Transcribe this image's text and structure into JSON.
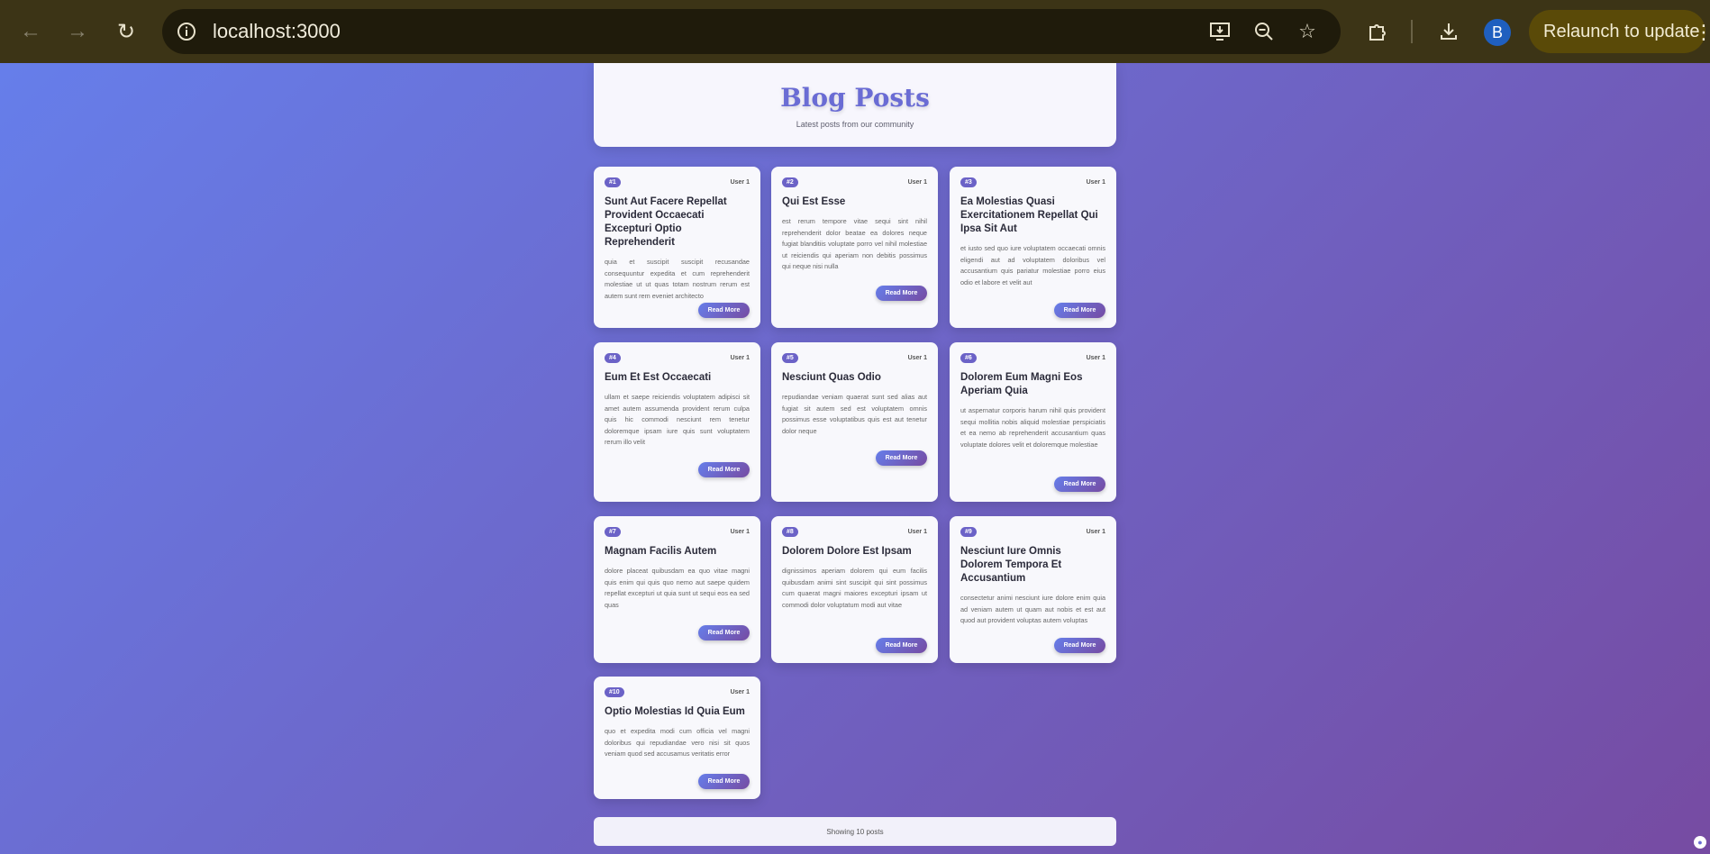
{
  "browser": {
    "url": "localhost:3000",
    "relaunch_label": "Relaunch to update",
    "profile_initial": "B",
    "icons": {
      "back": "arrow-left-icon",
      "forward": "arrow-right-icon",
      "reload": "reload-icon",
      "info": "info-icon",
      "install": "install-app-icon",
      "zoom": "zoom-out-icon",
      "bookmark": "star-icon",
      "extensions": "puzzle-icon",
      "downloads": "download-icon",
      "menu": "kebab-menu-icon"
    }
  },
  "page": {
    "title": "Blog Posts",
    "subtitle": "Latest posts from our community",
    "read_more_label": "Read More",
    "footer": "Showing 10 posts",
    "colors": {
      "gradient_start": "#667eea",
      "gradient_end": "#764ba2",
      "title": "#6a6cd4"
    }
  },
  "posts": [
    {
      "id": "#1",
      "user": "User 1",
      "title": "Sunt Aut Facere Repellat Provident Occaecati Excepturi Optio Reprehenderit",
      "body": "quia et suscipit suscipit recusandae consequuntur expedita et cum reprehenderit molestiae ut ut quas totam nostrum rerum est autem sunt rem eveniet architecto"
    },
    {
      "id": "#2",
      "user": "User 1",
      "title": "Qui Est Esse",
      "body": "est rerum tempore vitae sequi sint nihil reprehenderit dolor beatae ea dolores neque fugiat blanditiis voluptate porro vel nihil molestiae ut reiciendis qui aperiam non debitis possimus qui neque nisi nulla"
    },
    {
      "id": "#3",
      "user": "User 1",
      "title": "Ea Molestias Quasi Exercitationem Repellat Qui Ipsa Sit Aut",
      "body": "et iusto sed quo iure voluptatem occaecati omnis eligendi aut ad voluptatem doloribus vel accusantium quis pariatur molestiae porro eius odio et labore et velit aut"
    },
    {
      "id": "#4",
      "user": "User 1",
      "title": "Eum Et Est Occaecati",
      "body": "ullam et saepe reiciendis voluptatem adipisci sit amet autem assumenda provident rerum culpa quis hic commodi nesciunt rem tenetur doloremque ipsam iure quis sunt voluptatem rerum illo velit"
    },
    {
      "id": "#5",
      "user": "User 1",
      "title": "Nesciunt Quas Odio",
      "body": "repudiandae veniam quaerat sunt sed alias aut fugiat sit autem sed est voluptatem omnis possimus esse voluptatibus quis est aut tenetur dolor neque"
    },
    {
      "id": "#6",
      "user": "User 1",
      "title": "Dolorem Eum Magni Eos Aperiam Quia",
      "body": "ut aspernatur corporis harum nihil quis provident sequi mollitia nobis aliquid molestiae perspiciatis et ea nemo ab reprehenderit accusantium quas voluptate dolores velit et doloremque molestiae"
    },
    {
      "id": "#7",
      "user": "User 1",
      "title": "Magnam Facilis Autem",
      "body": "dolore placeat quibusdam ea quo vitae magni quis enim qui quis quo nemo aut saepe quidem repellat excepturi ut quia sunt ut sequi eos ea sed quas"
    },
    {
      "id": "#8",
      "user": "User 1",
      "title": "Dolorem Dolore Est Ipsam",
      "body": "dignissimos aperiam dolorem qui eum facilis quibusdam animi sint suscipit qui sint possimus cum quaerat magni maiores excepturi ipsam ut commodi dolor voluptatum modi aut vitae"
    },
    {
      "id": "#9",
      "user": "User 1",
      "title": "Nesciunt Iure Omnis Dolorem Tempora Et Accusantium",
      "body": "consectetur animi nesciunt iure dolore enim quia ad veniam autem ut quam aut nobis et est aut quod aut provident voluptas autem voluptas"
    },
    {
      "id": "#10",
      "user": "User 1",
      "title": "Optio Molestias Id Quia Eum",
      "body": "quo et expedita modi cum officia vel magni doloribus qui repudiandae vero nisi sit quos veniam quod sed accusamus veritatis error"
    }
  ]
}
